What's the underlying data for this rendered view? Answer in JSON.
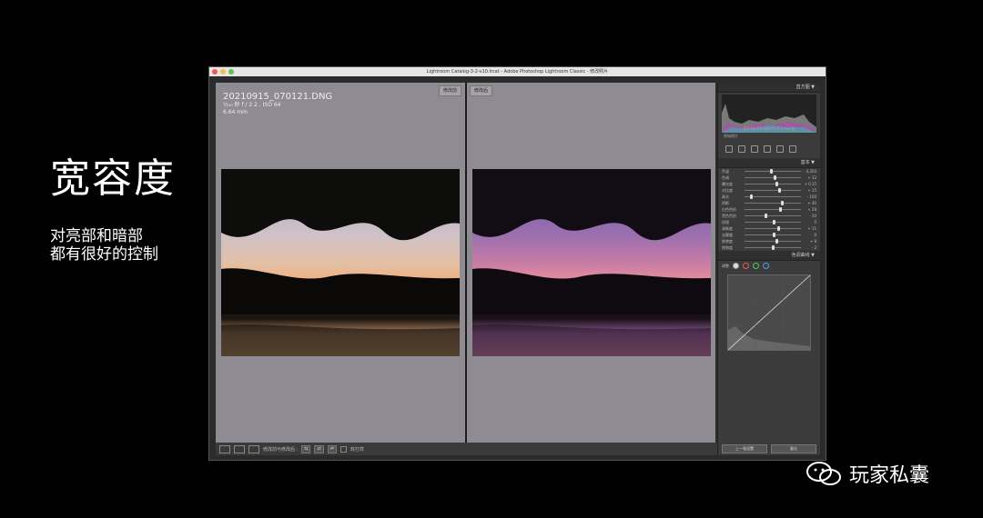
{
  "slide": {
    "title": "宽容度",
    "subtitle_lines": [
      "对亮部和暗部",
      "都有很好的控制"
    ]
  },
  "watermark": {
    "text": "玩家私囊"
  },
  "window": {
    "title": "Lightroom Catalog-3-2-v10.lrcat - Adobe Photoshop Lightroom Classic - 修改照片"
  },
  "left_pane": {
    "tag": "修改前",
    "filename": "20210915_070121.DNG",
    "exposure": "¹⁄₁₀₀ 秒 f / 2.2 , ISO 64",
    "focal": "6.64 mm"
  },
  "right_pane": {
    "tag": "修改后"
  },
  "bottombar": {
    "label": "修改前与修改后 :",
    "soft_proof": "软打样"
  },
  "panel": {
    "histogram_header": "直方图 ▼",
    "histogram_info": "ISO 64   6.6 mm   f / 2.2   ¹⁄₁₀₀ 秒",
    "original_photo": "原始照片",
    "basic_header": "基本 ▼",
    "basic_sliders": [
      {
        "label": "色温",
        "value": "4,350"
      },
      {
        "label": "色调",
        "value": "+ 32"
      },
      {
        "label": "曝光度",
        "value": "+ 0.15"
      },
      {
        "label": "对比度",
        "value": "+ 15"
      },
      {
        "label": "高光",
        "value": "- 100"
      },
      {
        "label": "阴影",
        "value": "+ 40"
      },
      {
        "label": "白色色阶",
        "value": "+ 28"
      },
      {
        "label": "黑色色阶",
        "value": "- 30"
      },
      {
        "label": "纹理",
        "value": "0"
      },
      {
        "label": "清晰度",
        "value": "+ 11"
      },
      {
        "label": "去朦胧",
        "value": "0"
      },
      {
        "label": "鲜艳度",
        "value": "+ 8"
      },
      {
        "label": "饱和度",
        "value": "- 2"
      }
    ],
    "curve_header": "色调曲线 ▼",
    "curve_channel": "调整",
    "btn_prev": "上一张设置",
    "btn_reset": "复位"
  },
  "colors": {
    "accent_red": "#ee5a52",
    "accent_yellow": "#f5be4f",
    "accent_green": "#5fc454"
  }
}
